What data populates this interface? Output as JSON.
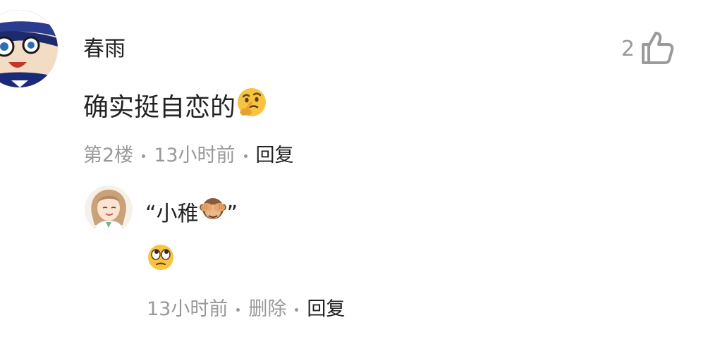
{
  "comment": {
    "username": "春雨",
    "likes": "2",
    "text": "确实挺自恋的",
    "text_emoji": "thinking-face",
    "floor": "第2楼",
    "time": "13小时前",
    "reply_label": "回复",
    "like_icon": "thumbs-up-outline-icon"
  },
  "reply": {
    "username_prefix": "“小稚",
    "username_emoji": "see-no-evil-monkey",
    "username_suffix": "”",
    "text_emoji": "face-with-rolling-eyes",
    "time": "13小时前",
    "delete_label": "删除",
    "reply_label": "回复"
  },
  "colors": {
    "primary_text": "#222222",
    "secondary_text": "#999999",
    "icon_gray": "#9a9a9a",
    "emoji_yellow": "#f7c340"
  }
}
